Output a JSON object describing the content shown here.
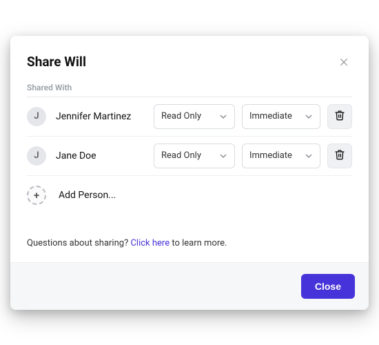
{
  "modal": {
    "title": "Share Will",
    "section_label": "Shared With",
    "people": [
      {
        "initial": "J",
        "name": "Jennifer Martinez",
        "access": "Read Only",
        "timing": "Immediate"
      },
      {
        "initial": "J",
        "name": "Jane Doe",
        "access": "Read Only",
        "timing": "Immediate"
      }
    ],
    "add_label": "Add Person...",
    "help": {
      "prefix": "Questions about sharing? ",
      "link_text": "Click here",
      "suffix": " to learn more."
    },
    "close_button": "Close"
  }
}
